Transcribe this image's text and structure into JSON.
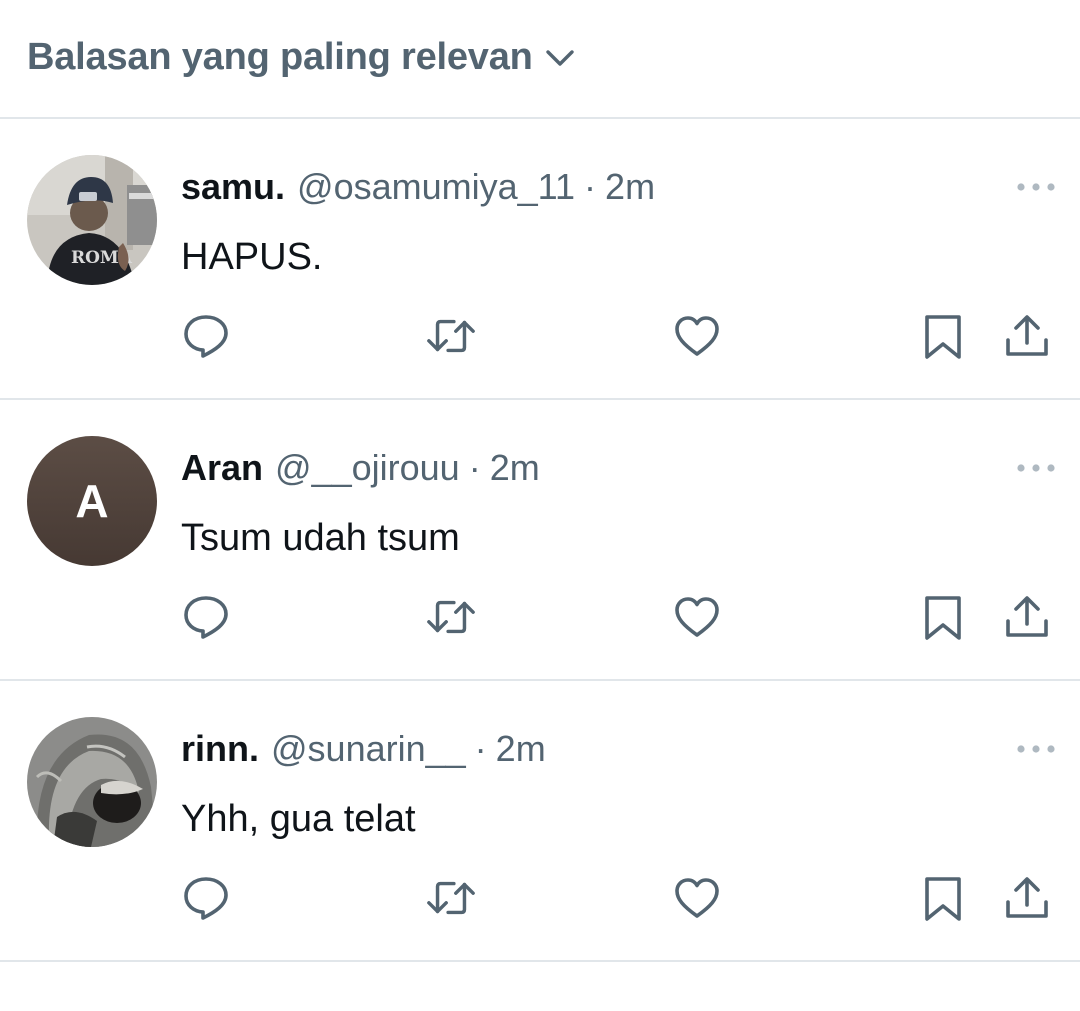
{
  "sort": {
    "label": "Balasan yang paling relevan",
    "icon": "chevron-down-icon"
  },
  "colors": {
    "primary_text": "#0f1419",
    "secondary_text": "#536471",
    "divider": "#e1e6ea",
    "icon": "#536471",
    "letter_avatar_bg": "#4f423b"
  },
  "replies": [
    {
      "name": "samu.",
      "handle": "@osamumiya_11",
      "separator": "·",
      "time": "2m",
      "text": "HAPUS.",
      "avatar": "photo-avatar"
    },
    {
      "name": "Aran",
      "handle": "@__ojirouu",
      "separator": "·",
      "time": "2m",
      "text": "Tsum udah tsum",
      "avatar": "letter-avatar",
      "avatar_letter": "A"
    },
    {
      "name": "rinn.",
      "handle": "@sunarin__",
      "separator": "·",
      "time": "2m",
      "text": "Yhh, gua telat",
      "avatar": "photo-avatar"
    }
  ],
  "actions": [
    "reply-icon",
    "retweet-icon",
    "like-icon",
    "bookmark-icon",
    "share-icon"
  ]
}
